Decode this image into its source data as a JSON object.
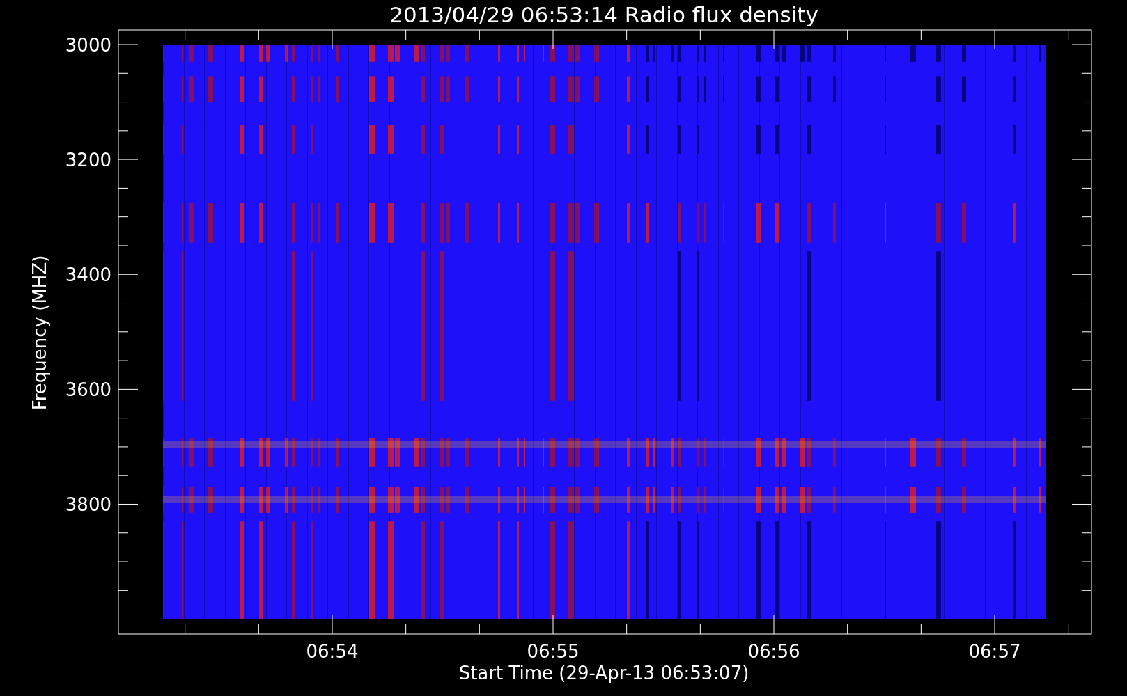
{
  "plot": {
    "title": "2013/04/29 06:53:14 Radio flux density",
    "ylabel": "Frequency (MHZ)",
    "xlabel": "Start Time (29-Apr-13 06:53:07)",
    "yticks": [
      "3000",
      "3200",
      "3400",
      "3600",
      "3800"
    ],
    "xticks": [
      "06:54",
      "06:55",
      "06:56",
      "06:57"
    ]
  }
}
